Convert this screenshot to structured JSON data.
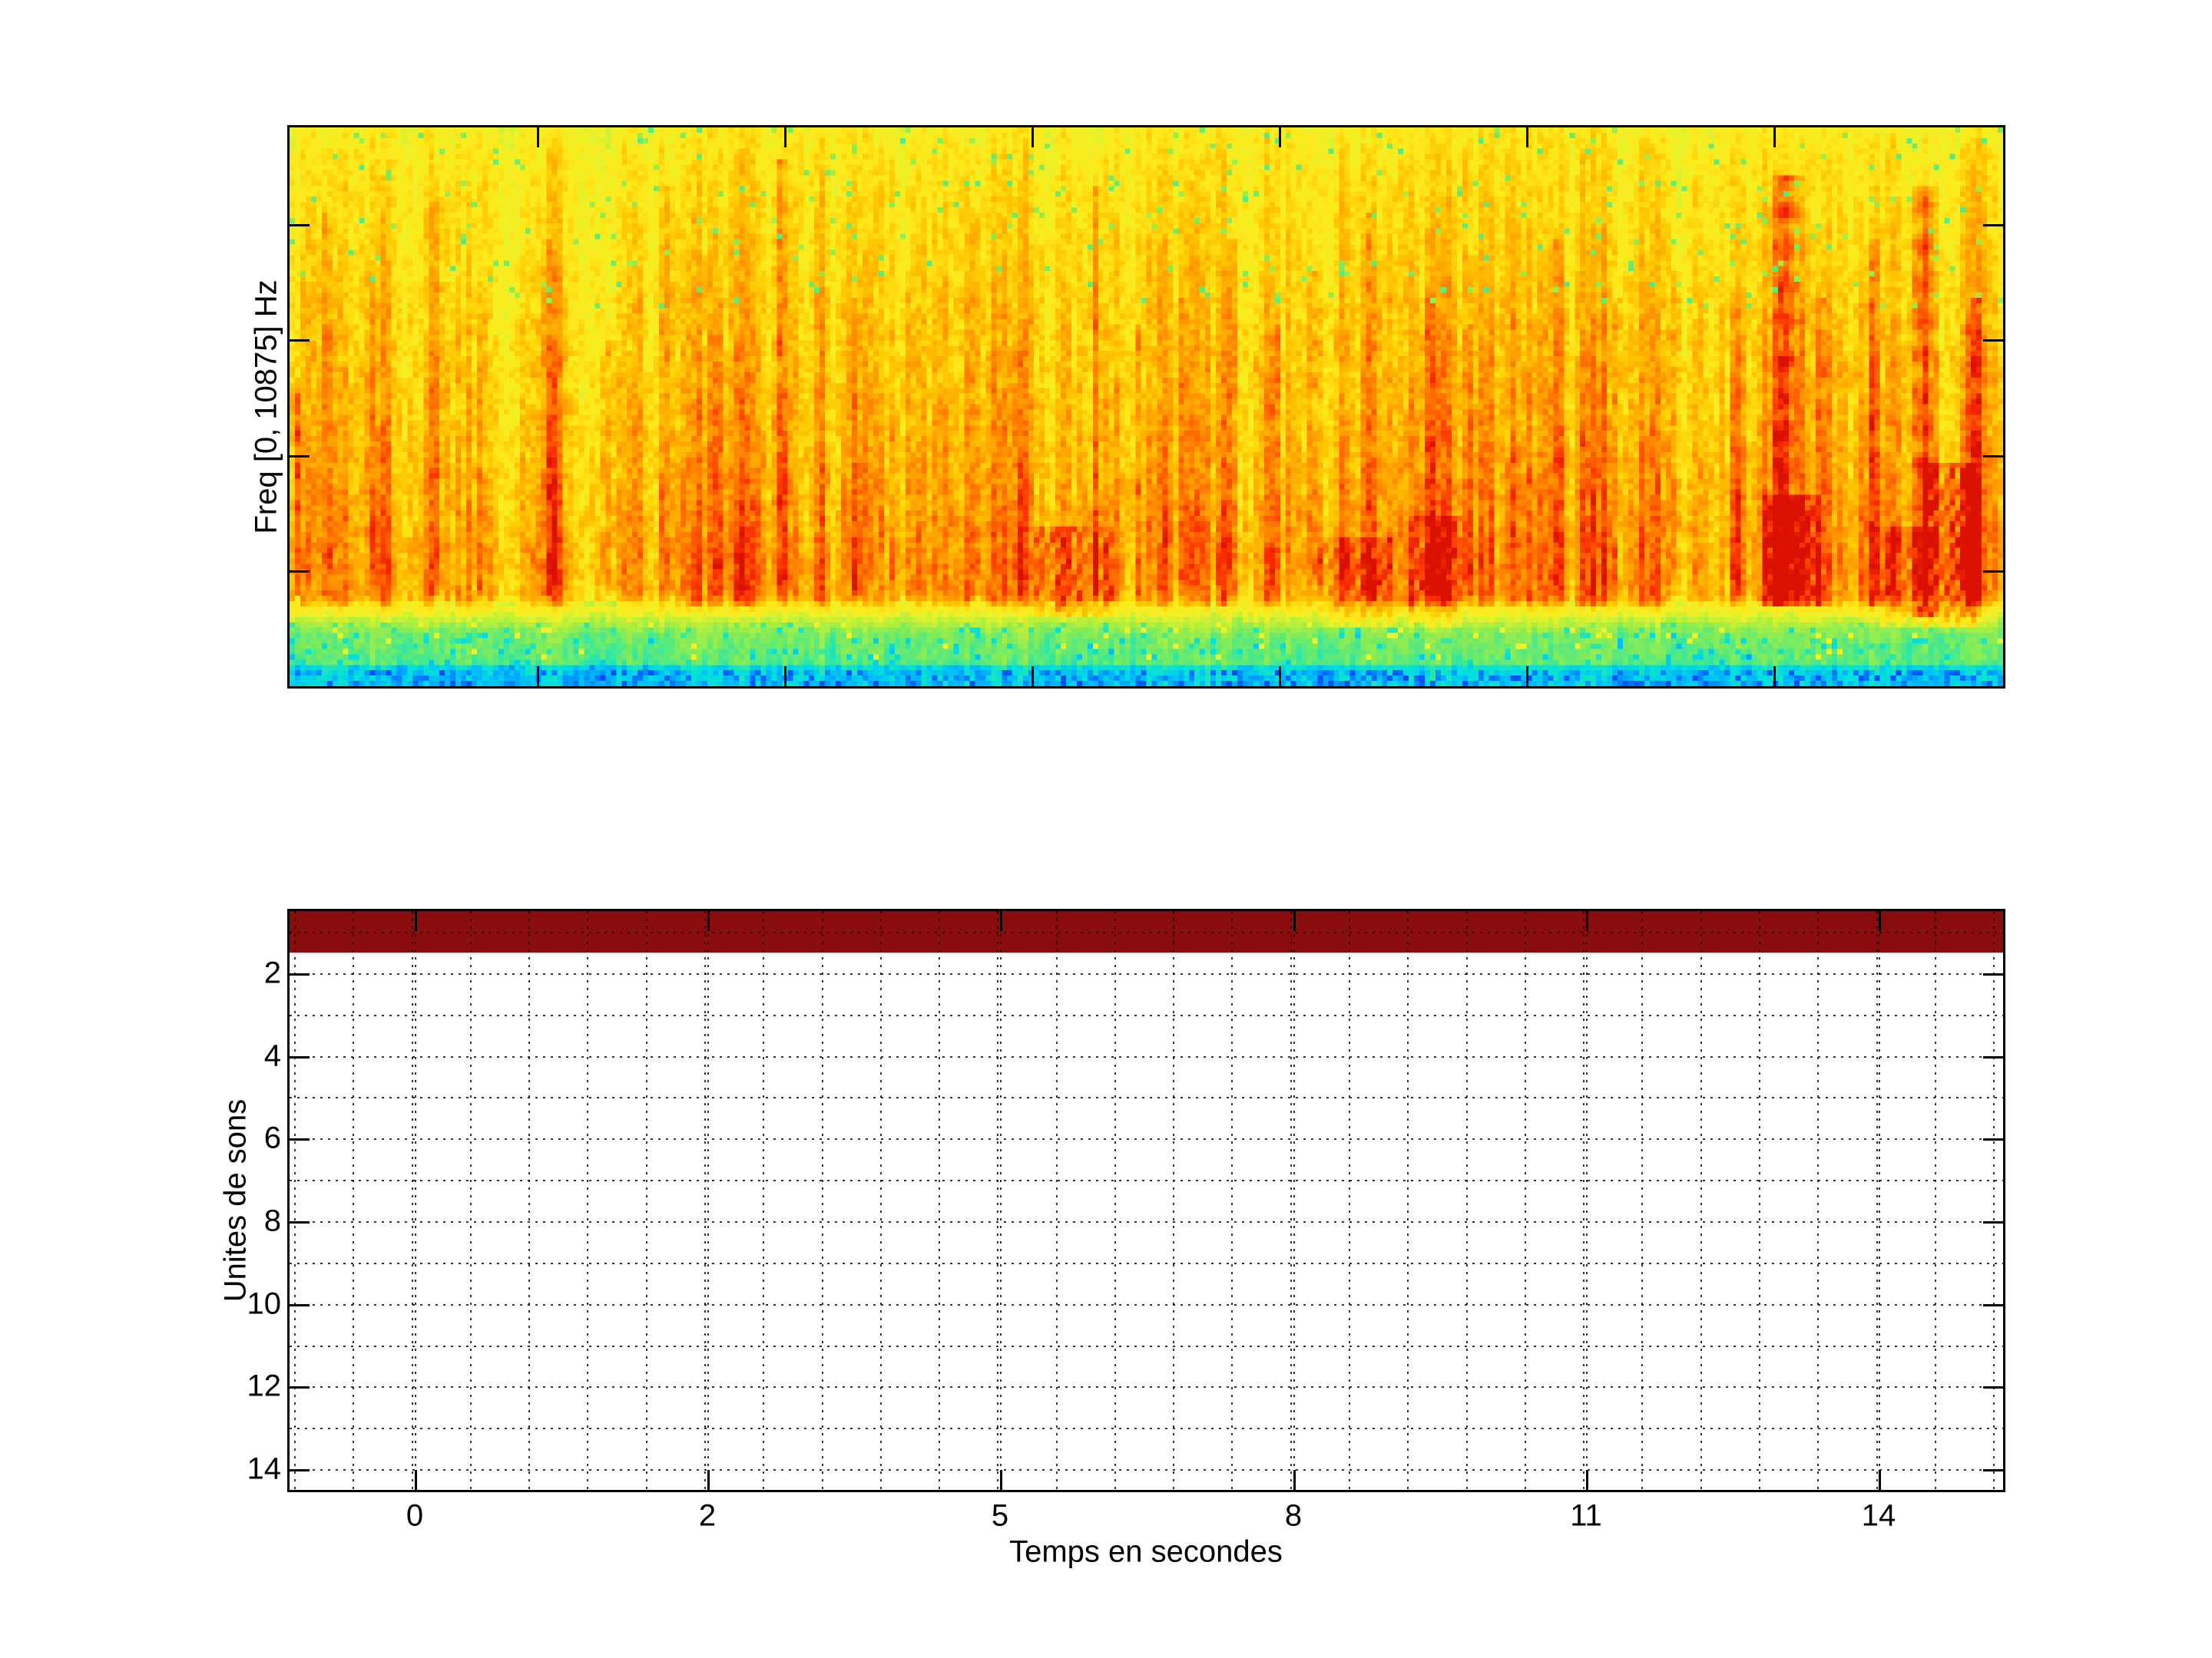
{
  "figure": {
    "background": "#ffffff",
    "kind": "matlab-style figure, two stacked subplots, no title"
  },
  "chart_data": [
    {
      "type": "heatmap",
      "subplot": "top-spectrogram",
      "title": "",
      "xlabel": "",
      "ylabel": "Freq [0, 10875] Hz",
      "colormap": "jet",
      "x_range_s": [
        0,
        13.86
      ],
      "x_ticks_s": [
        2,
        4,
        6,
        8,
        10,
        12
      ],
      "x_tick_labels": [],
      "y_range_hz": [
        0,
        10875
      ],
      "y_ticks_hz": [
        2250,
        4500,
        6750,
        9000
      ],
      "y_tick_labels": [],
      "grid": "off",
      "box": "on, ticks inward on all four edges",
      "content_summary": "noisy bioacoustic spectrogram: yellow background, orange density increasing toward low frequencies, many vertical red call streaks, darkest red horizontal band just above a green band, green-cyan band in the lowest ~11% of frequencies, cyan/blue speckled bottom rows, two strong dark-red call clusters near the right side with chevron (herringbone) patterns",
      "render_params": {
        "grid_cols": 320,
        "grid_rows": 105,
        "seed": 1337,
        "palette_stops": [
          [
            0.0,
            "#0020c0"
          ],
          [
            0.06,
            "#0055ff"
          ],
          [
            0.12,
            "#00b4ff"
          ],
          [
            0.18,
            "#00e0e0"
          ],
          [
            0.26,
            "#35e8a0"
          ],
          [
            0.34,
            "#7cec5e"
          ],
          [
            0.43,
            "#b8f03a"
          ],
          [
            0.52,
            "#eef229"
          ],
          [
            0.6,
            "#ffe81a"
          ],
          [
            0.68,
            "#ffc400"
          ],
          [
            0.76,
            "#ff9800"
          ],
          [
            0.84,
            "#ff6400"
          ],
          [
            0.91,
            "#fa2d00"
          ],
          [
            0.97,
            "#d80f00"
          ],
          [
            1.0,
            "#8b0000"
          ]
        ],
        "vertical_profile": [
          [
            0.0,
            0.575
          ],
          [
            0.05,
            0.61
          ],
          [
            0.3,
            0.665
          ],
          [
            0.58,
            0.725
          ],
          [
            0.79,
            0.785
          ],
          [
            0.845,
            0.76
          ],
          [
            0.862,
            0.6
          ],
          [
            0.888,
            0.44
          ],
          [
            0.91,
            0.345
          ],
          [
            0.962,
            0.3
          ],
          [
            0.972,
            0.17
          ],
          [
            1.0,
            0.15
          ]
        ],
        "streaks": [
          [
            0.003,
            0.003,
            0.24,
            0.45,
            0.84
          ],
          [
            0.02,
            0.004,
            0.12,
            0.15,
            0.84
          ],
          [
            0.045,
            0.004,
            0.11,
            0.25,
            0.84
          ],
          [
            0.085,
            0.005,
            0.14,
            0.12,
            0.84
          ],
          [
            0.11,
            0.004,
            0.1,
            0.3,
            0.84
          ],
          [
            0.15,
            0.005,
            0.12,
            0.2,
            0.84
          ],
          [
            0.185,
            0.006,
            0.13,
            0.35,
            0.84
          ],
          [
            0.22,
            0.005,
            0.12,
            0.1,
            0.84
          ],
          [
            0.25,
            0.004,
            0.11,
            0.3,
            0.84
          ],
          [
            0.285,
            0.005,
            0.17,
            0.05,
            0.84
          ],
          [
            0.33,
            0.004,
            0.1,
            0.3,
            0.84
          ],
          [
            0.36,
            0.004,
            0.12,
            0.25,
            0.84
          ],
          [
            0.4,
            0.005,
            0.13,
            0.15,
            0.84
          ],
          [
            0.425,
            0.004,
            0.1,
            0.4,
            0.84
          ],
          [
            0.47,
            0.005,
            0.15,
            0.1,
            0.84
          ],
          [
            0.495,
            0.004,
            0.11,
            0.35,
            0.84
          ],
          [
            0.52,
            0.004,
            0.1,
            0.3,
            0.84
          ],
          [
            0.55,
            0.005,
            0.13,
            0.2,
            0.84
          ],
          [
            0.575,
            0.004,
            0.11,
            0.35,
            0.84
          ],
          [
            0.6,
            0.005,
            0.12,
            0.25,
            0.84
          ],
          [
            0.63,
            0.004,
            0.12,
            0.15,
            0.84
          ],
          [
            0.665,
            0.005,
            0.11,
            0.3,
            0.84
          ],
          [
            0.69,
            0.004,
            0.1,
            0.35,
            0.84
          ],
          [
            0.74,
            0.005,
            0.13,
            0.2,
            0.84
          ],
          [
            0.775,
            0.004,
            0.11,
            0.3,
            0.84
          ],
          [
            0.81,
            0.005,
            0.12,
            0.25,
            0.84
          ],
          [
            0.845,
            0.005,
            0.11,
            0.3,
            0.84
          ],
          [
            0.875,
            0.012,
            0.24,
            0.08,
            0.86
          ],
          [
            0.895,
            0.006,
            0.14,
            0.3,
            0.86
          ],
          [
            0.925,
            0.005,
            0.12,
            0.2,
            0.86
          ],
          [
            0.955,
            0.012,
            0.26,
            0.1,
            0.88
          ],
          [
            0.985,
            0.006,
            0.16,
            0.3,
            0.88
          ]
        ],
        "chevron_patches": [
          [
            0.435,
            0.48,
            0.72,
            0.88,
            0.16
          ],
          [
            0.6,
            0.645,
            0.74,
            0.9,
            0.14
          ],
          [
            0.655,
            0.685,
            0.7,
            0.9,
            0.12
          ],
          [
            0.862,
            0.895,
            0.66,
            0.86,
            0.2
          ],
          [
            0.93,
            0.955,
            0.72,
            0.9,
            0.16
          ],
          [
            0.955,
            0.985,
            0.6,
            0.9,
            0.22
          ]
        ]
      }
    },
    {
      "type": "heatmap",
      "subplot": "bottom-classification",
      "title": "",
      "xlabel": "Temps en secondes",
      "ylabel": "Unites de sons",
      "x_tick_labels": [
        "0",
        "2",
        "5",
        "8",
        "11",
        "14"
      ],
      "x_tick_fracs": [
        0.0729,
        0.2438,
        0.4148,
        0.5857,
        0.7567,
        0.9276
      ],
      "x_minor_frac_start": 0.0027,
      "x_minor_frac_step": 0.03419,
      "y_range_units": [
        0.5,
        14.5
      ],
      "y_ticks_units": [
        2,
        4,
        6,
        8,
        10,
        12,
        14
      ],
      "y_tick_labels": [
        "2",
        "4",
        "6",
        "8",
        "10",
        "12",
        "14"
      ],
      "y_minor_step_units": 1,
      "grid": "dotted major and minor gridlines, drawn over data",
      "box": "on, ticks inward",
      "values_summary": "sound-unit 1 active for the entire recording; all other units empty",
      "active_row": 1,
      "active_row_span": [
        0.5,
        1.5
      ],
      "active_color": "#8a0d0d",
      "empty_color": "#ffffff"
    }
  ]
}
